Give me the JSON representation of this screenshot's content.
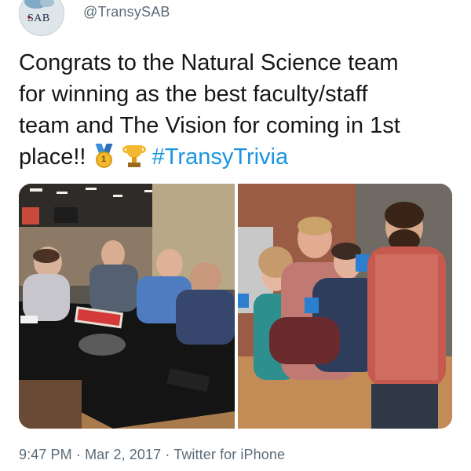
{
  "tweet": {
    "avatar_text": "SAB",
    "handle": "@TransySAB",
    "text_line1": "Congrats to the Natural Science team",
    "text_line2": "for winning as the best faculty/staff",
    "text_line3": "team and The Vision for coming in 1st",
    "text_line4_prefix": "place!!",
    "medal_digit": "1",
    "hashtag": "#TransyTrivia",
    "time": "9:47 PM",
    "date": "Mar 2, 2017",
    "source": "Twitter for iPhone",
    "separator": "·"
  },
  "icons": {
    "medal": "first-place-medal-icon",
    "trophy": "trophy-icon"
  },
  "colors": {
    "text": "#14171a",
    "secondary": "#5b6b78",
    "link": "#1b95e0"
  }
}
